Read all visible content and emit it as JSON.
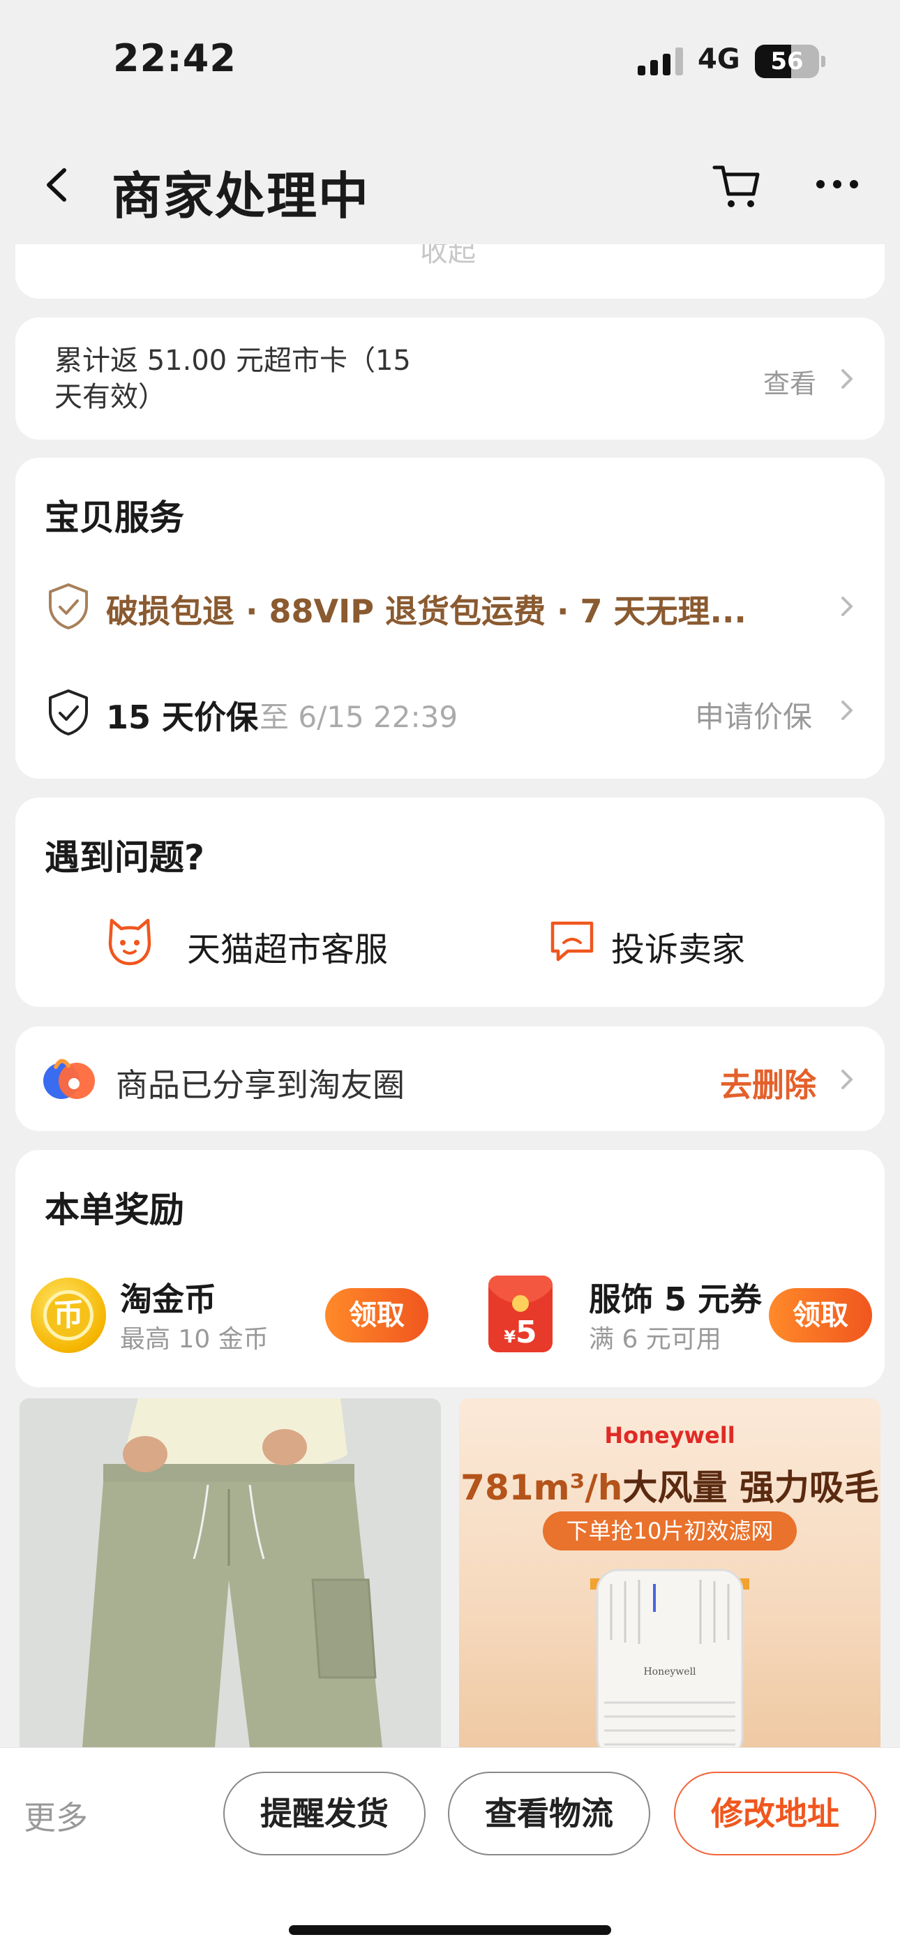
{
  "status_bar": {
    "time": "22:42",
    "network": "4G",
    "battery": "56",
    "battery_level": 0.56
  },
  "nav": {
    "title": "商家处理中",
    "back_icon": "chevron-left-icon",
    "cart_icon": "cart-icon",
    "more_icon": "more-dots-icon"
  },
  "clipped_card": {
    "text": "收起"
  },
  "cashback": {
    "text": "累计返 51.00 元超市卡（15 天有效）",
    "link": "查看"
  },
  "services": {
    "title": "宝贝服务",
    "guarantee_line": "破损包退 · 88VIP 退货包运费 · 7 天无理...",
    "price_protect": "15 天价保",
    "price_until": "至 6/15 22:39",
    "price_apply": "申请价保"
  },
  "help": {
    "title": "遇到问题?",
    "customer_service": "天猫超市客服",
    "complain": "投诉卖家"
  },
  "share": {
    "text": "商品已分享到淘友圈",
    "action": "去删除"
  },
  "rewards": {
    "title": "本单奖励",
    "items": [
      {
        "title": "淘金币",
        "subtitle": "最高 10 金币",
        "button": "领取",
        "icon": "coin-icon",
        "icon_glyph": "币"
      },
      {
        "title": "服饰 5 元券",
        "subtitle": "满 6 元可用",
        "button": "领取",
        "icon": "red-packet-icon",
        "icon_currency": "¥",
        "icon_amount": "5"
      }
    ]
  },
  "products": {
    "right": {
      "brand": "Honeywell",
      "slogan_a": "781m³/h",
      "slogan_b": "大风量 强力吸毛",
      "pill": "下单抢10片初效滤网",
      "device_brand": "Honeywell"
    }
  },
  "bottom_bar": {
    "more": "更多",
    "buttons": [
      "提醒发货",
      "查看物流",
      "修改地址"
    ]
  },
  "colors": {
    "accent": "#f0561e",
    "brown": "#8a5a30",
    "bg": "#f0f0f0"
  }
}
